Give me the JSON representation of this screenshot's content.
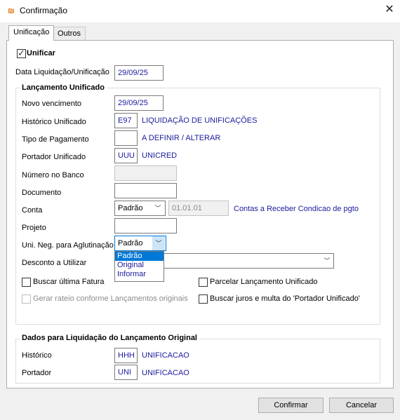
{
  "window": {
    "title": "Confirmação",
    "app_icon_glyph": "₪",
    "close_glyph": "✕"
  },
  "tabs": [
    {
      "label": "Unificação",
      "active": true
    },
    {
      "label": "Outros",
      "active": false
    }
  ],
  "unificar": {
    "label": "Unificar",
    "checked": true
  },
  "data_liquidacao": {
    "label": "Data Liquidação/Unificação",
    "value": "29/09/25"
  },
  "lancamento_unificado": {
    "title": "Lançamento Unificado",
    "novo_vencimento": {
      "label": "Novo vencimento",
      "value": "29/09/25"
    },
    "historico": {
      "label": "Histórico Unificado",
      "code": "E97",
      "description": "LIQUIDAÇÃO DE UNIFICAÇÕES"
    },
    "tipo_pagamento": {
      "label": "Tipo de Pagamento",
      "code": "",
      "description": "A DEFINIR / ALTERAR"
    },
    "portador": {
      "label": "Portador Unificado",
      "code": "UUU",
      "description": "UNICRED"
    },
    "numero_banco": {
      "label": "Número no Banco",
      "value": ""
    },
    "documento": {
      "label": "Documento",
      "value": ""
    },
    "conta": {
      "label": "Conta",
      "select_value": "Padrão",
      "code": "01.01.01",
      "description": "Contas a Receber Condicao de pgto"
    },
    "projeto": {
      "label": "Projeto",
      "value": ""
    },
    "uni_neg": {
      "label": "Uni. Neg. para Aglutinação",
      "select_value": "Padrão",
      "options": [
        "Padrão",
        "Original",
        "Informar"
      ],
      "highlighted": "Padrão"
    },
    "desconto": {
      "label": "Desconto a Utilizar",
      "value": ""
    },
    "buscar_ultima_fatura": {
      "label": "Buscar última Fatura",
      "checked": false
    },
    "parcelar": {
      "label": "Parcelar Lançamento Unificado",
      "checked": false
    },
    "gerar_rateio": {
      "label": "Gerar rateio conforme Lançamentos originais",
      "checked": false,
      "disabled": true
    },
    "buscar_juros": {
      "label": "Buscar juros e multa do 'Portador Unificado'",
      "checked": false
    }
  },
  "dados_liquidacao": {
    "title": "Dados para Liquidação do Lançamento Original",
    "historico": {
      "label": "Histórico",
      "code": "HHH",
      "description": "UNIFICACAO"
    },
    "portador": {
      "label": "Portador",
      "code": "UNI",
      "description": "UNIFICACAO"
    }
  },
  "buttons": {
    "confirmar": "Confirmar",
    "cancelar": "Cancelar"
  },
  "colors": {
    "value_text": "#1a1a9c",
    "selection": "#0078d7",
    "disabled_text": "#8b8b8b"
  },
  "icons": {
    "combo_arrow": "﹀",
    "checkmark": "✓"
  }
}
